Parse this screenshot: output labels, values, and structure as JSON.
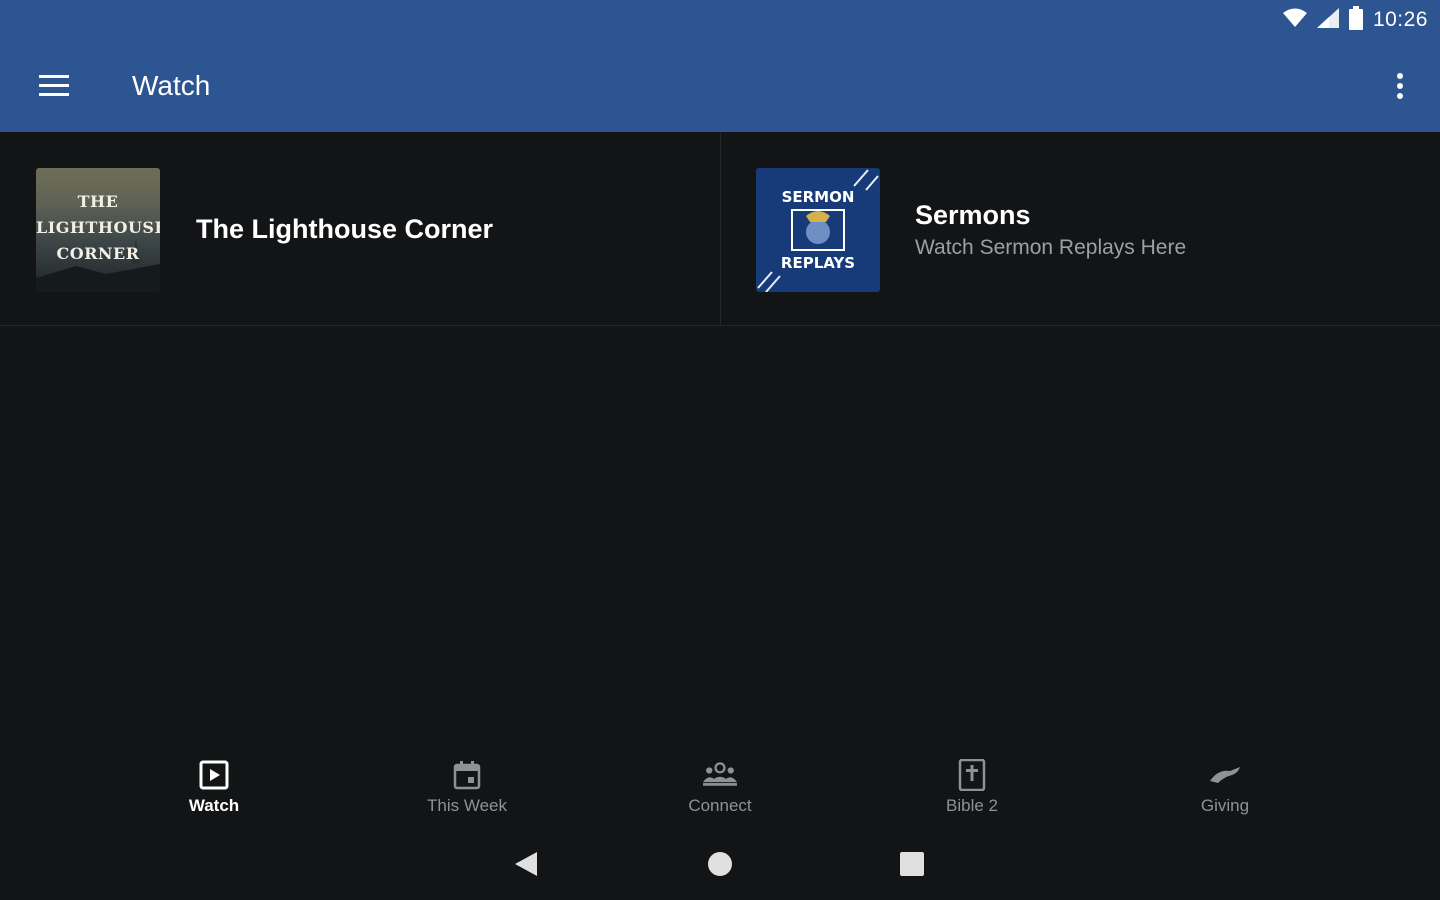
{
  "status_bar": {
    "time": "10:26",
    "icons": [
      "wifi-icon",
      "signal-icon",
      "battery-icon"
    ]
  },
  "app_bar": {
    "title": "Watch",
    "menu_icon": "hamburger-menu-icon",
    "overflow_icon": "more-vertical-icon",
    "color": "#2d5592"
  },
  "cards": [
    {
      "title": "The Lighthouse Corner",
      "subtitle": "",
      "thumbnail_text": [
        "THE",
        "LIGHTHOUSE",
        "CORNER"
      ]
    },
    {
      "title": "Sermons",
      "subtitle": "Watch Sermon Replays Here",
      "thumbnail_text": [
        "SERMON",
        "REPLAYS"
      ]
    }
  ],
  "bottom_nav": {
    "items": [
      {
        "label": "Watch",
        "icon": "play-box-icon",
        "active": true
      },
      {
        "label": "This Week",
        "icon": "calendar-icon",
        "active": false
      },
      {
        "label": "Connect",
        "icon": "group-icon",
        "active": false
      },
      {
        "label": "Bible 2",
        "icon": "bible-icon",
        "active": false
      },
      {
        "label": "Giving",
        "icon": "giving-hand-icon",
        "active": false
      }
    ]
  },
  "system_nav": {
    "icons": [
      "back-icon",
      "home-icon",
      "recents-icon"
    ]
  },
  "colors": {
    "background": "#121416",
    "accent": "#2d5592",
    "muted_text": "#8e9296"
  }
}
